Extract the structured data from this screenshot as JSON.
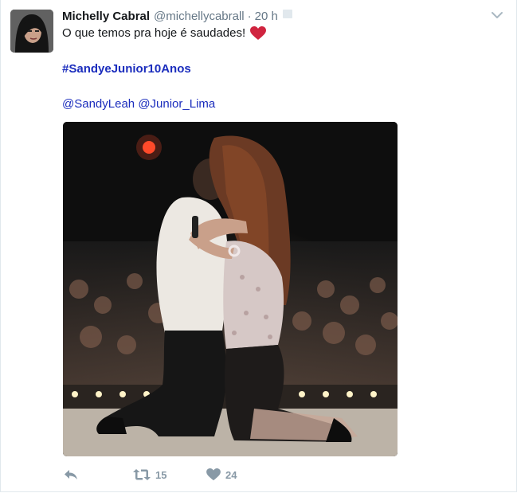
{
  "tweet": {
    "display_name": "Michelly Cabral",
    "username": "@michellycabrall",
    "separator": "·",
    "timestamp": "20 h",
    "text": "O que temos pra hoje é saudades!",
    "hashtag": "#SandyeJunior10Anos",
    "mentions": [
      "@SandyLeah",
      "@Junior_Lima"
    ],
    "emoji": "red-heart-emoji"
  },
  "actions": {
    "reply_icon": "reply-icon",
    "retweet_icon": "retweet-icon",
    "retweet_count": "15",
    "like_icon": "heart-icon",
    "like_count": "24"
  },
  "colors": {
    "link": "#1b2dbd",
    "muted": "#657786",
    "action_gray": "#8899a6",
    "heart_red": "#d0243f",
    "text": "#14171a",
    "border": "#e1e8ed"
  }
}
